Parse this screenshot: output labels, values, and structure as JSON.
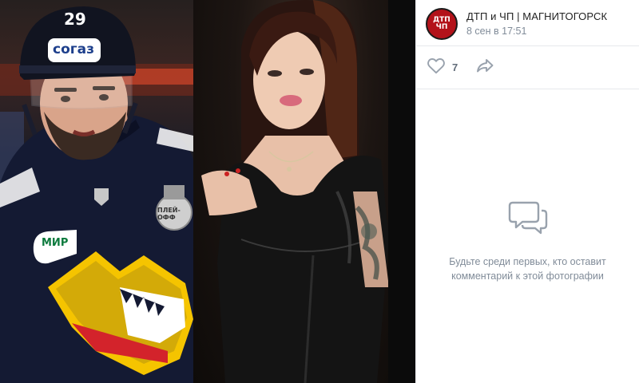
{
  "post": {
    "author_name": "ДТП и ЧП | МАГНИТОГОРСК",
    "date": "8 сен в 17:51",
    "avatar_text": [
      "ДТП",
      "ЧП"
    ]
  },
  "actions": {
    "like_count": "7"
  },
  "comments": {
    "empty_message": "Будьте среди первых, кто оставит комментарий к этой фотографии"
  },
  "photo": {
    "left_panel": {
      "player_number": "29",
      "helmet_sponsor": "согаз",
      "chest_sponsor": "МИР",
      "patch_text": "ПЛЕЙ-ОФФ"
    }
  },
  "icons": [
    "heart-icon",
    "share-icon",
    "comment-bubbles-icon"
  ],
  "colors": {
    "accent_red": "#b3121a",
    "muted_text": "#818c99",
    "icon_gray": "#99a2ad",
    "divider": "#e7e8ec",
    "jersey_navy": "#141a33",
    "logo_yellow": "#f5c400"
  }
}
